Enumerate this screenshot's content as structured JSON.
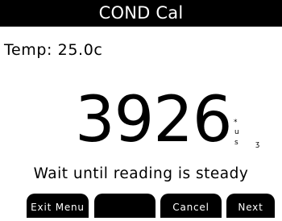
{
  "title": "COND Cal",
  "temperature": "Temp: 25.0c",
  "reading": {
    "value": "3926",
    "flag_star": "*",
    "unit_u": "u",
    "unit_s": "s",
    "flag_trailing": "ʒ"
  },
  "status_message": "Wait until reading is steady",
  "softkeys": [
    {
      "label": "Exit Menu"
    },
    {
      "label": ""
    },
    {
      "label": "Cancel"
    },
    {
      "label": "Next"
    }
  ],
  "colors": {
    "background": "#ffffff",
    "title_bar": "#000000",
    "title_text": "#ffffff",
    "softkey_bg": "#000000",
    "softkey_text": "#ffffff"
  }
}
